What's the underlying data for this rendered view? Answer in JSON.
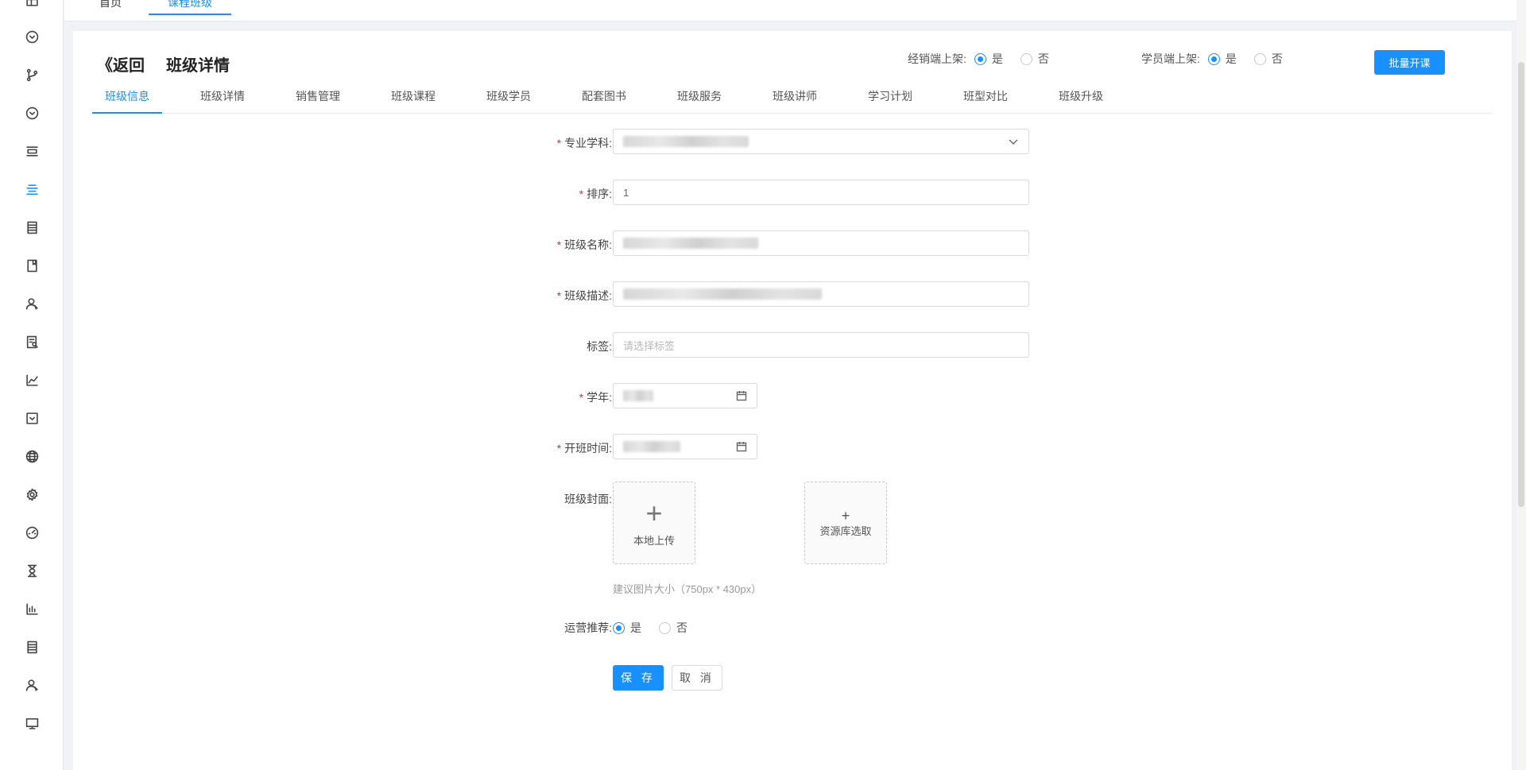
{
  "sidebar": {
    "icons": [
      "home-icon",
      "chevron-circle-icon",
      "branch-icon",
      "chevron-circle-icon",
      "layers-icon",
      "list-icon",
      "document-icon",
      "book-icon",
      "users-icon",
      "report-icon",
      "chart-line-icon",
      "checkbox-icon",
      "globe-icon",
      "gear-icon",
      "dashboard-icon",
      "hourglass-icon",
      "bar-chart-icon",
      "document-icon",
      "users-icon",
      "monitor-icon"
    ],
    "active_index": 5
  },
  "top_tabs": [
    {
      "label": "首页"
    },
    {
      "label": "课程班级"
    }
  ],
  "header": {
    "back_label": "《返回",
    "title": "班级详情",
    "dealer_shelf_label": "经销端上架:",
    "student_shelf_label": "学员端上架:",
    "yes_label": "是",
    "no_label": "否",
    "dealer_shelf_value": "是",
    "student_shelf_value": "是",
    "batch_button": "批量开课"
  },
  "sub_tabs": [
    "班级信息",
    "班级详情",
    "销售管理",
    "班级课程",
    "班级学员",
    "配套图书",
    "班级服务",
    "班级讲师",
    "学习计划",
    "班型对比",
    "班级升级"
  ],
  "active_sub_tab": 0,
  "form": {
    "subject_label": "专业学科:",
    "order_label": "排序:",
    "order_value": "1",
    "name_label": "班级名称:",
    "desc_label": "班级描述:",
    "tag_label": "标签:",
    "tag_placeholder": "请选择标签",
    "year_label": "学年:",
    "start_label": "开班时间:",
    "cover_label": "班级封面:",
    "local_upload": "本地上传",
    "library_select": "资源库选取",
    "cover_hint": "建议图片大小（750px * 430px）",
    "recommend_label": "运营推荐:",
    "recommend_value": "是",
    "save_button": "保 存",
    "cancel_button": "取 消"
  },
  "colors": {
    "primary": "#1890ff",
    "required": "#f5222d"
  }
}
